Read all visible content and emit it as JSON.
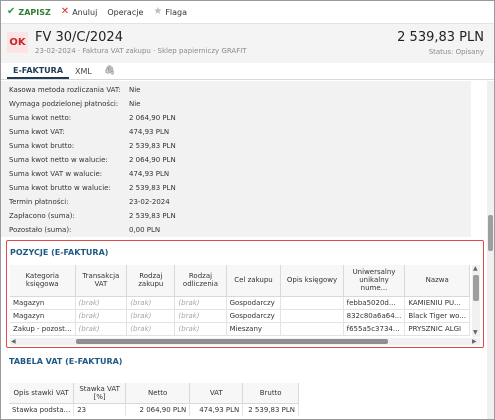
{
  "toolbar": {
    "save_label": "ZAPISZ",
    "cancel_label": "Anuluj",
    "operations_label": "Operacje",
    "flag_label": "Flaga"
  },
  "header": {
    "badge": "OK",
    "title": "FV 30/C/2024",
    "subtitle": "23-02-2024  ·  Faktura VAT zakupu  ·  Sklep papierniczy GRAFIT",
    "amount": "2 539,83 PLN",
    "status": "Status: Opisany"
  },
  "tabs": {
    "efaktura": "E-FAKTURA",
    "xml": "XML"
  },
  "fields": [
    {
      "label": "Kasowa metoda rozliczania VAT:",
      "value": "Nie"
    },
    {
      "label": "Wymaga podzielonej płatności:",
      "value": "Nie"
    },
    {
      "label": "Suma kwot netto:",
      "value": "2 064,90 PLN"
    },
    {
      "label": "Suma kwot VAT:",
      "value": "474,93 PLN"
    },
    {
      "label": "Suma kwot brutto:",
      "value": "2 539,83 PLN"
    },
    {
      "label": "Suma kwot netto w walucie:",
      "value": "2 064,90 PLN"
    },
    {
      "label": "Suma kwot VAT w walucie:",
      "value": "474,93 PLN"
    },
    {
      "label": "Suma kwot brutto w walucie:",
      "value": "2 539,83 PLN"
    },
    {
      "label": "Termin płatności:",
      "value": "23-02-2024"
    },
    {
      "label": "Zapłacono (suma):",
      "value": "2 539,83 PLN"
    },
    {
      "label": "Pozostało (suma):",
      "value": "0,00 PLN"
    }
  ],
  "pozycje": {
    "title": "POZYCJE (E-FAKTURA)",
    "columns": [
      "Kategoria księgowa",
      "Transakcja VAT",
      "Rodzaj zakupu",
      "Rodzaj odliczenia",
      "Cel zakupu",
      "Opis księgowy",
      "Uniwersalny unikalny nume...",
      "Nazwa"
    ],
    "rows": [
      [
        "Magazyn",
        "(brak)",
        "(brak)",
        "(brak)",
        "Gospodarczy",
        "",
        "febba5020d...",
        "KAMIENIU PU..."
      ],
      [
        "Magazyn",
        "(brak)",
        "(brak)",
        "(brak)",
        "Gospodarczy",
        "",
        "832c80a6a64...",
        "Black Tiger wo..."
      ],
      [
        "Zakup - pozost...",
        "(brak)",
        "(brak)",
        "(brak)",
        "Mieszany",
        "",
        "f655a5c3734...",
        "PRYSZNIC ALGI"
      ]
    ]
  },
  "vat": {
    "title": "TABELA VAT (E-FAKTURA)",
    "columns": [
      "Opis stawki VAT",
      "Stawka VAT [%]",
      "Netto",
      "VAT",
      "Brutto"
    ],
    "rows": [
      [
        "Stawka podsta...",
        "23",
        "2 064,90 PLN",
        "474,93 PLN",
        "2 539,83 PLN"
      ]
    ]
  }
}
